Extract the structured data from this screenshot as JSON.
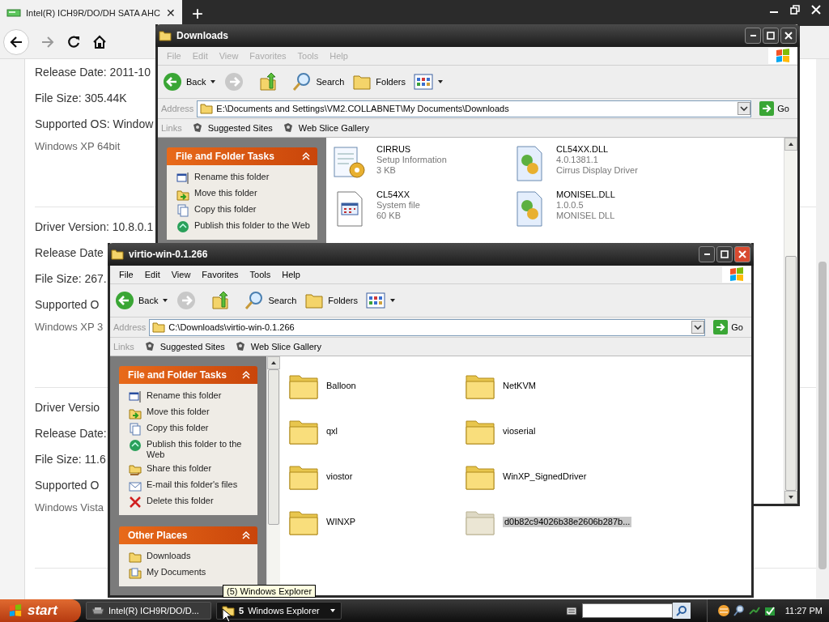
{
  "browser": {
    "tab": {
      "title": "Intel(R) ICH9R/DO/DH SATA AHC",
      "close": "✕"
    },
    "new_tab": "+",
    "sections": [
      {
        "lines": [
          {
            "kind": "field",
            "text": "Release Date: 2011-10"
          },
          {
            "kind": "field",
            "text": "File Size: 305.44K"
          },
          {
            "kind": "field",
            "text": "Supported OS: Window"
          },
          {
            "kind": "os",
            "text": "Windows XP 64bit"
          }
        ]
      },
      {
        "lines": [
          {
            "kind": "field",
            "text": "Driver Version: 10.8.0.1"
          },
          {
            "kind": "field",
            "text": "Release Date"
          },
          {
            "kind": "field",
            "text": "File Size: 267."
          },
          {
            "kind": "field",
            "text": "Supported O"
          },
          {
            "kind": "os",
            "text": "Windows XP 3"
          }
        ]
      },
      {
        "lines": [
          {
            "kind": "field",
            "text": "Driver Versio"
          },
          {
            "kind": "field",
            "text": "Release Date:"
          },
          {
            "kind": "field",
            "text": "File Size: 11.6"
          },
          {
            "kind": "field",
            "text": "Supported O"
          },
          {
            "kind": "os",
            "text": "Windows Vista"
          }
        ]
      }
    ]
  },
  "windows": [
    {
      "title": "Downloads",
      "active": false,
      "menu": [
        "File",
        "Edit",
        "View",
        "Favorites",
        "Tools",
        "Help"
      ],
      "toolbar": {
        "back": "Back",
        "search": "Search",
        "folders": "Folders"
      },
      "address": {
        "label": "Address",
        "value": "E:\\Documents and Settings\\VM2.COLLABNET\\My Documents\\Downloads",
        "go": "Go"
      },
      "links": {
        "label": "Links",
        "items": [
          "Suggested Sites",
          "Web Slice Gallery"
        ]
      },
      "panels": [
        {
          "kind": "tasks",
          "title": "File and Folder Tasks",
          "items": [
            "Rename this folder",
            "Move this folder",
            "Copy this folder",
            "Publish this folder to the Web"
          ]
        }
      ],
      "items": [
        {
          "kind": "inf",
          "name": "CIRRUS",
          "details": [
            "Setup Information",
            "3 KB"
          ],
          "selected": false
        },
        {
          "kind": "dll",
          "name": "CL54XX.DLL",
          "details": [
            "4.0.1381.1",
            "Cirrus Display Driver"
          ],
          "selected": false
        },
        {
          "kind": "sys",
          "name": "CL54XX",
          "details": [
            "System file",
            "60 KB"
          ],
          "selected": false
        },
        {
          "kind": "dll",
          "name": "MONISEL.DLL",
          "details": [
            "1.0.0.5",
            "MONISEL DLL"
          ],
          "selected": false
        }
      ]
    },
    {
      "title": "virtio-win-0.1.266",
      "active": true,
      "menu": [
        "File",
        "Edit",
        "View",
        "Favorites",
        "Tools",
        "Help"
      ],
      "toolbar": {
        "back": "Back",
        "search": "Search",
        "folders": "Folders"
      },
      "address": {
        "label": "Address",
        "value": "C:\\Downloads\\virtio-win-0.1.266",
        "go": "Go"
      },
      "links": {
        "label": "Links",
        "items": [
          "Suggested Sites",
          "Web Slice Gallery"
        ]
      },
      "panels": [
        {
          "kind": "tasks",
          "title": "File and Folder Tasks",
          "items": [
            "Rename this folder",
            "Move this folder",
            "Copy this folder",
            "Publish this folder to the Web",
            "Share this folder",
            "E-mail this folder's files",
            "Delete this folder"
          ]
        },
        {
          "kind": "places",
          "title": "Other Places",
          "items": [
            "Downloads",
            "My Documents"
          ]
        }
      ],
      "items": [
        {
          "kind": "folder",
          "name": "Balloon",
          "selected": false
        },
        {
          "kind": "folder",
          "name": "NetKVM",
          "selected": false
        },
        {
          "kind": "folder",
          "name": "qxl",
          "selected": false
        },
        {
          "kind": "folder",
          "name": "vioserial",
          "selected": false
        },
        {
          "kind": "folder",
          "name": "viostor",
          "selected": false
        },
        {
          "kind": "folder",
          "name": "WinXP_SignedDriver",
          "selected": false
        },
        {
          "kind": "folder",
          "name": "WINXP",
          "selected": false
        },
        {
          "kind": "folder",
          "name": "d0b82c94026b38e2606b287b...",
          "selected": true
        }
      ]
    }
  ],
  "tooltip": "(5) Windows Explorer",
  "taskbar": {
    "start": "start",
    "tasks": [
      {
        "label": "Intel(R) ICH9R/DO/D...",
        "selected": false
      },
      {
        "count": "5",
        "label": "Windows Explorer",
        "selected": true
      }
    ],
    "clock": "11:27 PM"
  }
}
